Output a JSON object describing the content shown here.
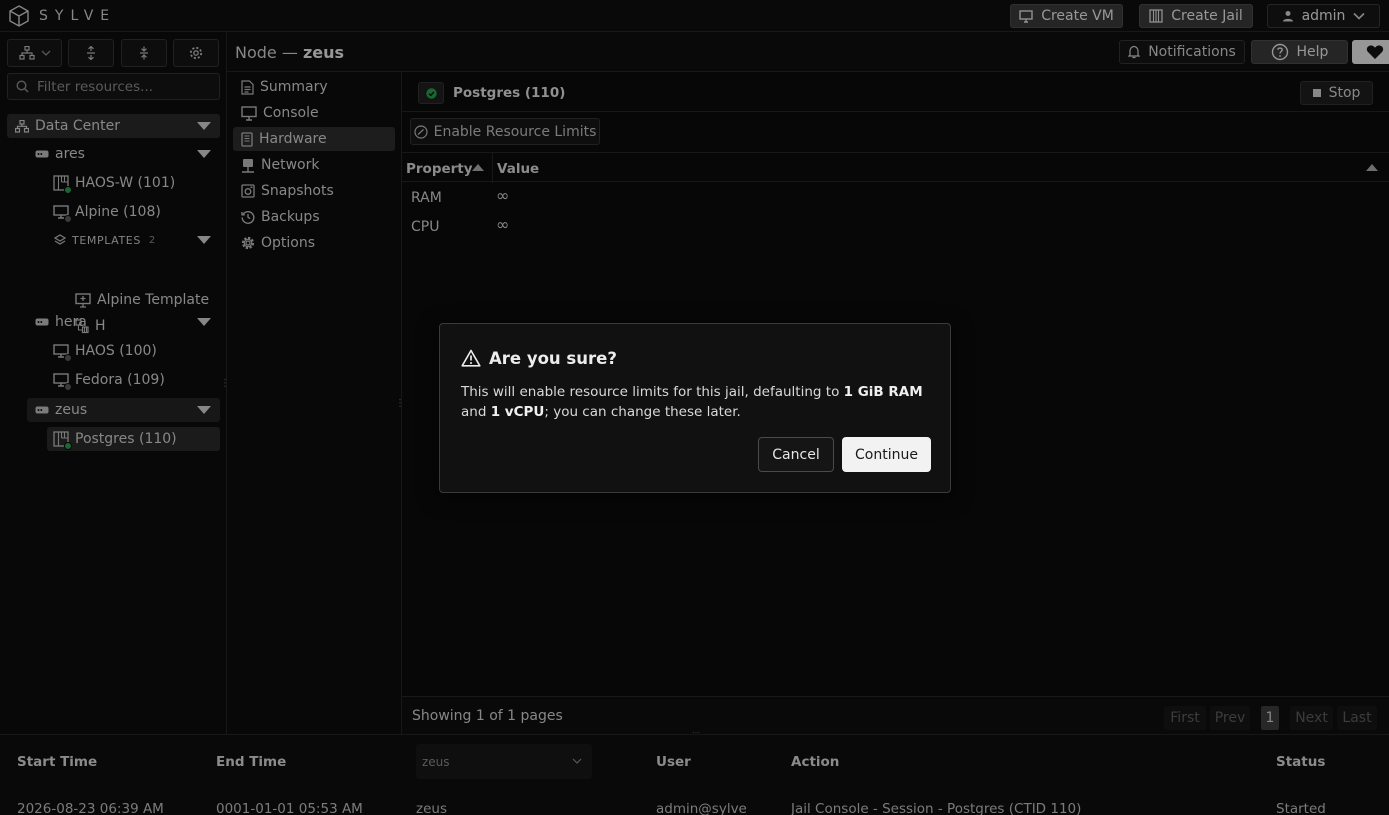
{
  "app": {
    "name": "SYLVE"
  },
  "topbar": {
    "create_vm": "Create VM",
    "create_jail": "Create Jail",
    "user": "admin"
  },
  "search": {
    "placeholder": "Filter resources..."
  },
  "tree": {
    "datacenter": "Data Center",
    "ares": "ares",
    "haos_w": "HAOS-W (101)",
    "alpine": "Alpine (108)",
    "templates": "TEMPLATES",
    "templates_count": "2",
    "alpine_template": "Alpine Template",
    "h": "H",
    "hera": "hera",
    "haos": "HAOS (100)",
    "fedora": "Fedora (109)",
    "zeus": "zeus",
    "postgres": "Postgres (110)"
  },
  "header": {
    "node_prefix": "Node —",
    "node_name": "zeus",
    "notifications": "Notifications",
    "help": "Help"
  },
  "nav": {
    "items": [
      "Summary",
      "Console",
      "Hardware",
      "Network",
      "Snapshots",
      "Backups",
      "Options"
    ],
    "active": "Hardware"
  },
  "jail": {
    "name": "Postgres (110)",
    "stop": "Stop",
    "enable_limits": "Enable Resource Limits"
  },
  "table": {
    "headers": {
      "property": "Property",
      "value": "Value"
    },
    "rows": [
      {
        "property": "RAM",
        "value": "∞"
      },
      {
        "property": "CPU",
        "value": "∞"
      }
    ],
    "footer": "Showing 1 of 1 pages",
    "pager": {
      "first": "First",
      "prev": "Prev",
      "current": "1",
      "next": "Next",
      "last": "Last"
    }
  },
  "log": {
    "headers": {
      "start": "Start Time",
      "end": "End Time",
      "user": "User",
      "action": "Action",
      "status": "Status"
    },
    "node_filter": "zeus",
    "row": {
      "start": "2026-08-23 06:39 AM",
      "end": "0001-01-01 05:53 AM",
      "node": "zeus",
      "user": "admin@sylve",
      "action": "Jail Console - Session - Postgres (CTID 110)",
      "status": "Started"
    }
  },
  "dialog": {
    "title": "Are you sure?",
    "text_before": "This will enable resource limits for this jail, defaulting to ",
    "ram": "1 GiB RAM",
    "and": " and ",
    "cpu": "1 vCPU",
    "text_after": "; you can change these later.",
    "cancel": "Cancel",
    "continue": "Continue"
  },
  "colors": {
    "running": "#27a04a",
    "stopped": "#5a5a5a",
    "accent": "#f2f2f2"
  }
}
